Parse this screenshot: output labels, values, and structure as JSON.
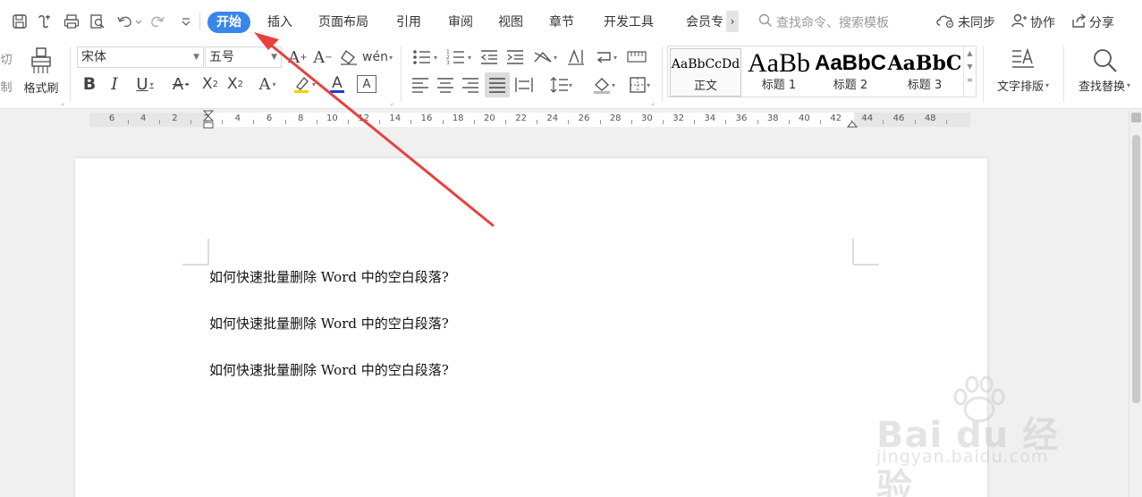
{
  "quick_access": {
    "icons": [
      "save-icon",
      "open-icon",
      "print-icon",
      "print-preview-icon",
      "undo-icon",
      "redo-icon",
      "customize-icon"
    ]
  },
  "tabs": [
    {
      "label": "开始",
      "active": true
    },
    {
      "label": "插入",
      "active": false
    },
    {
      "label": "页面布局",
      "active": false
    },
    {
      "label": "引用",
      "active": false
    },
    {
      "label": "审阅",
      "active": false
    },
    {
      "label": "视图",
      "active": false
    },
    {
      "label": "章节",
      "active": false
    },
    {
      "label": "开发工具",
      "active": false
    },
    {
      "label": "会员专",
      "active": false
    }
  ],
  "tab_more_glyph": "›",
  "search": {
    "placeholder": "查找命令、搜索模板"
  },
  "right_actions": {
    "sync": "未同步",
    "collab": "协作",
    "share": "分享"
  },
  "ribbon": {
    "clipboard": {
      "cut_partial": "切",
      "copy_partial": "制",
      "format_painter": "格式刷"
    },
    "font": {
      "family": "宋体",
      "size": "五号"
    },
    "styles": [
      {
        "sample": "AaBbCcDd",
        "name": "正文"
      },
      {
        "sample": "AaBb",
        "name": "标题 1"
      },
      {
        "sample": "AaBbC",
        "name": "标题 2"
      },
      {
        "sample": "AaBbC",
        "name": "标题 3"
      }
    ],
    "text_layout": "文字排版",
    "find_replace": "查找替换"
  },
  "ruler": {
    "labels": [
      "6",
      "4",
      "2",
      "2",
      "4",
      "6",
      "8",
      "10",
      "12",
      "14",
      "16",
      "18",
      "20",
      "22",
      "24",
      "26",
      "28",
      "30",
      "32",
      "34",
      "36",
      "38",
      "40",
      "42",
      "44",
      "46",
      "48"
    ]
  },
  "document": {
    "paragraphs": [
      "如何快速批量删除 Word 中的空白段落?",
      "如何快速批量删除 Word 中的空白段落?",
      "如何快速批量删除 Word 中的空白段落?"
    ]
  },
  "watermark": {
    "brand": "Bai du 经验",
    "url": "jingyan.baidu.com"
  },
  "colors": {
    "accent": "#3a86e8",
    "annotation_arrow": "#e8413c",
    "font_color_bar": "#1a3fd6"
  }
}
